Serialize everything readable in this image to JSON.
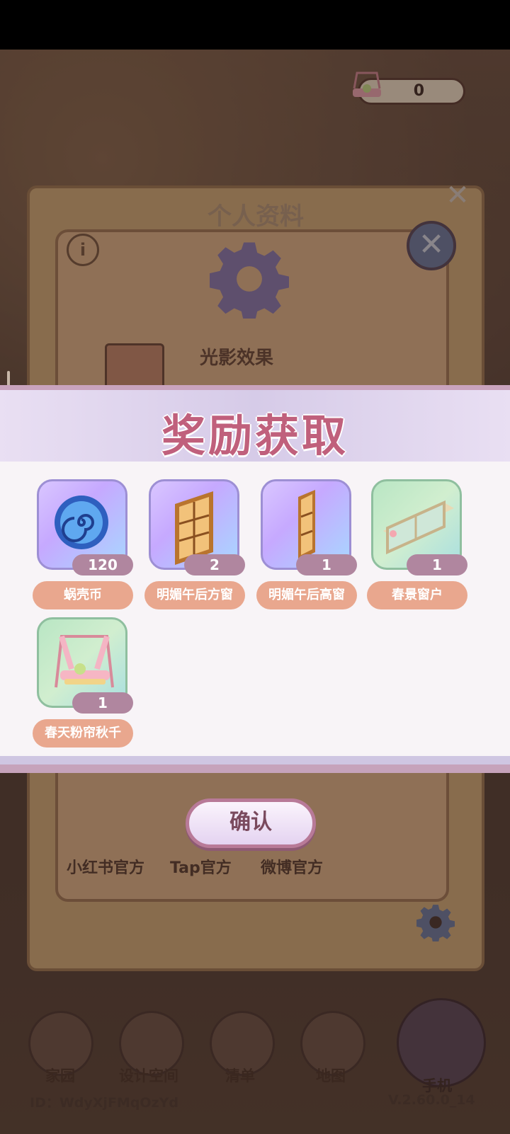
{
  "currency": {
    "value": "0"
  },
  "profile": {
    "title": "个人资料",
    "light_effect_label": "光影效果",
    "socials": [
      "小红书官方",
      "Tap官方",
      "微博官方"
    ]
  },
  "nav": {
    "items": [
      "家园",
      "设计空间",
      "清单",
      "地图"
    ],
    "phone_label": "手机"
  },
  "footer": {
    "id_text": "ID：WdyXjFMqOzYd",
    "version": "V.2.60.0_14"
  },
  "reward": {
    "title": "奖励获取",
    "items": [
      {
        "name": "蜗壳币",
        "count": "120",
        "icon": "snail-coin-icon"
      },
      {
        "name": "明媚午后方窗",
        "count": "2",
        "icon": "square-window-icon"
      },
      {
        "name": "明媚午后高窗",
        "count": "1",
        "icon": "tall-window-icon"
      },
      {
        "name": "春景窗户",
        "count": "1",
        "icon": "spring-window-icon"
      },
      {
        "name": "春天粉帘秋千",
        "count": "1",
        "icon": "pink-swing-icon"
      }
    ],
    "confirm_label": "确认"
  },
  "colors": {
    "title": "#c0607c",
    "tag_name": "#e9a78e",
    "tag_count": "#b0869f"
  }
}
